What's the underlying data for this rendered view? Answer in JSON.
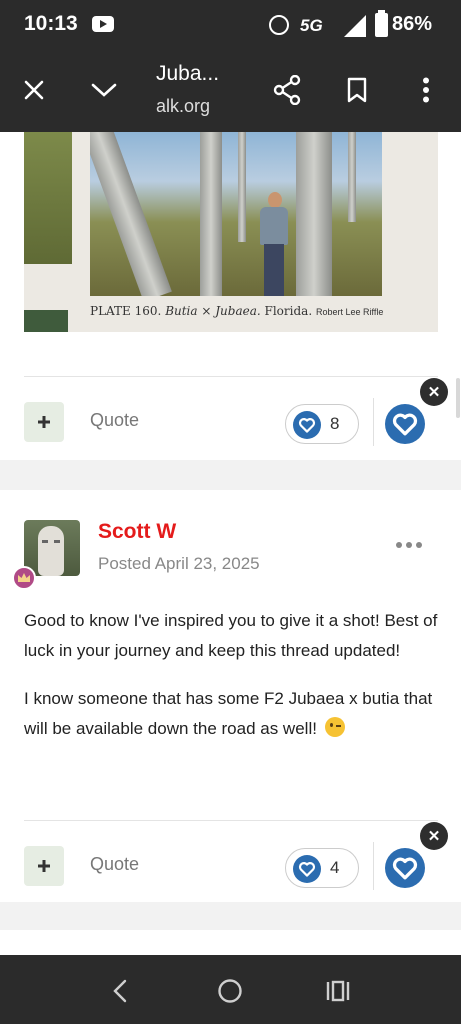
{
  "status_bar": {
    "time": "10:13",
    "network": "5G",
    "battery": "86%",
    "icons": [
      "youtube-icon",
      "alarm-icon",
      "signal-icon",
      "battery-icon"
    ]
  },
  "browser": {
    "title": "Juba...",
    "url": "alk.org",
    "icons": [
      "close-icon",
      "chevron-down-icon",
      "share-icon",
      "bookmark-icon",
      "more-vert-icon"
    ]
  },
  "post1": {
    "image_caption_prefix": "PLATE 160.",
    "image_caption_species": "Butia × Jubaea.",
    "image_caption_location": "Florida.",
    "image_caption_credit": "Robert Lee Riffle",
    "quote_label": "Quote",
    "reaction_count": "8"
  },
  "post2": {
    "author": "Scott W",
    "posted": "Posted April 23, 2025",
    "paragraphs": [
      "Good to know I've inspired you to give it a shot! Best of luck in your journey and keep this thread updated!",
      "I know someone that has some F2 Jubaea x butia that will be available down the road as well!"
    ],
    "quote_label": "Quote",
    "reaction_count": "4"
  },
  "nav": {
    "icons": [
      "back-icon",
      "home-icon",
      "recents-icon"
    ]
  },
  "colors": {
    "accent_blue": "#2b6cb0",
    "author_red": "#e41b1b",
    "system_bar": "#2b2b2b"
  }
}
